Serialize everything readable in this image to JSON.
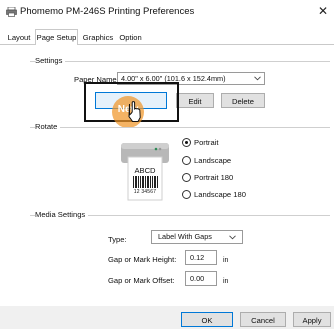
{
  "window": {
    "title": "Phomemo PM-246S Printing Preferences",
    "close_glyph": "✕"
  },
  "tabs": [
    {
      "label": "Layout",
      "active": false
    },
    {
      "label": "Page Setup",
      "active": true
    },
    {
      "label": "Graphics",
      "active": false
    },
    {
      "label": "Option",
      "active": false
    }
  ],
  "settings": {
    "group_label": "Settings",
    "paper_name_label": "Paper Name:",
    "paper_name_value": "4.00\" x 6.00\" (101.6 x 152.4mm)",
    "new_button": "New",
    "edit_button": "Edit",
    "delete_button": "Delete"
  },
  "rotate": {
    "group_label": "Rotate",
    "preview_text": "ABCD",
    "preview_barcode_number": "12 34567",
    "options": [
      {
        "label": "Portrait",
        "selected": true
      },
      {
        "label": "Landscape",
        "selected": false
      },
      {
        "label": "Portrait 180",
        "selected": false
      },
      {
        "label": "Landscape 180",
        "selected": false
      }
    ]
  },
  "media": {
    "group_label": "Media Settings",
    "type_label": "Type:",
    "type_value": "Label With Gaps",
    "gap_height_label": "Gap or Mark Height:",
    "gap_height_value": "0.12",
    "gap_height_unit": "in",
    "gap_offset_label": "Gap or Mark Offset:",
    "gap_offset_value": "0.00",
    "gap_offset_unit": "in"
  },
  "footer": {
    "ok": "OK",
    "cancel": "Cancel",
    "apply": "Apply"
  },
  "colors": {
    "highlight_circle": "#f09628",
    "selected_button_border": "#0078d7",
    "footer_bg": "#f0f0f0"
  },
  "icons": {
    "title": "printer-icon",
    "dropdown": "chevron-down-icon",
    "cursor": "mouse-pointer-icon"
  }
}
